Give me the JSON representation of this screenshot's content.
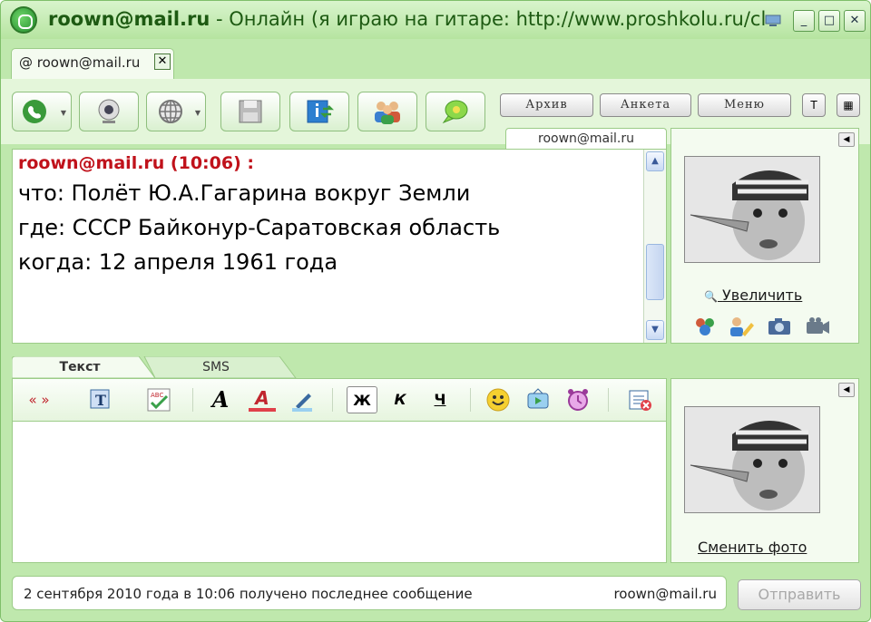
{
  "window": {
    "username": "roown@mail.ru",
    "title_rest": " - Онлайн (я играю на гитаре: http://www.proshkolu.ru/clu...",
    "minimize": "_",
    "maximize": "□",
    "close": "✕"
  },
  "tab": {
    "label": "roown@mail.ru",
    "close": "✕"
  },
  "toolbar": {
    "archive": "Архив",
    "profile": "Анкета",
    "menu": "Меню"
  },
  "chat": {
    "contact_tab": "roown@mail.ru",
    "message": {
      "header": "roown@mail.ru (10:06) :",
      "lines": [
        "что: Полёт Ю.А.Гагарина вокруг Земли",
        "где: СССР Байконур-Саратовская область",
        "когда: 12 апреля 1961 года"
      ]
    }
  },
  "contact_panel": {
    "zoom_link": "Увеличить"
  },
  "compose": {
    "tab_text": "Текст",
    "tab_sms": "SMS",
    "bold": "Ж",
    "italic": "К",
    "underline": "Ч",
    "quote": "« »"
  },
  "my_panel": {
    "change_photo": "Сменить фото"
  },
  "status": {
    "text": "2 сентября 2010 года в 10:06 получено последнее сообщение",
    "user": "roown@mail.ru"
  },
  "send_button": "Отправить"
}
